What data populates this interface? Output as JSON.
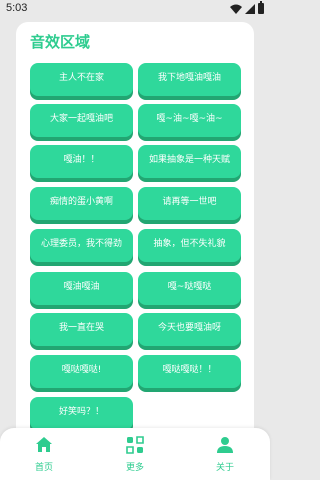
{
  "status_bar": {
    "time": "5:03"
  },
  "section": {
    "title": "音效区域"
  },
  "sounds": [
    "主人不在家",
    "我下地嘎油嘎油",
    "大家一起嘎油吧",
    "嘎~油~嘎~油~",
    "嘎油！！",
    "如果抽象是一种天赋",
    "痴情的蛋小黄啊",
    "请再等一世吧",
    "心理委员，我不得劲",
    "抽象，但不失礼貌",
    "嘎油嘎油",
    "嘎~哒嘎哒",
    "我一直在哭",
    "今天也要嘎油呀",
    "嘎哒嘎哒!",
    "嘎哒嘎哒！！",
    "好笑吗？！"
  ],
  "nav": {
    "home": "首页",
    "more": "更多",
    "about": "关于"
  },
  "colors": {
    "accent": "#2ecc8f",
    "button": "#2fd89b",
    "button_shadow": "#22a672",
    "background": "#e9e9e9"
  },
  "icons": {
    "home": "home-icon",
    "more": "grid-more-icon",
    "about": "person-icon"
  }
}
